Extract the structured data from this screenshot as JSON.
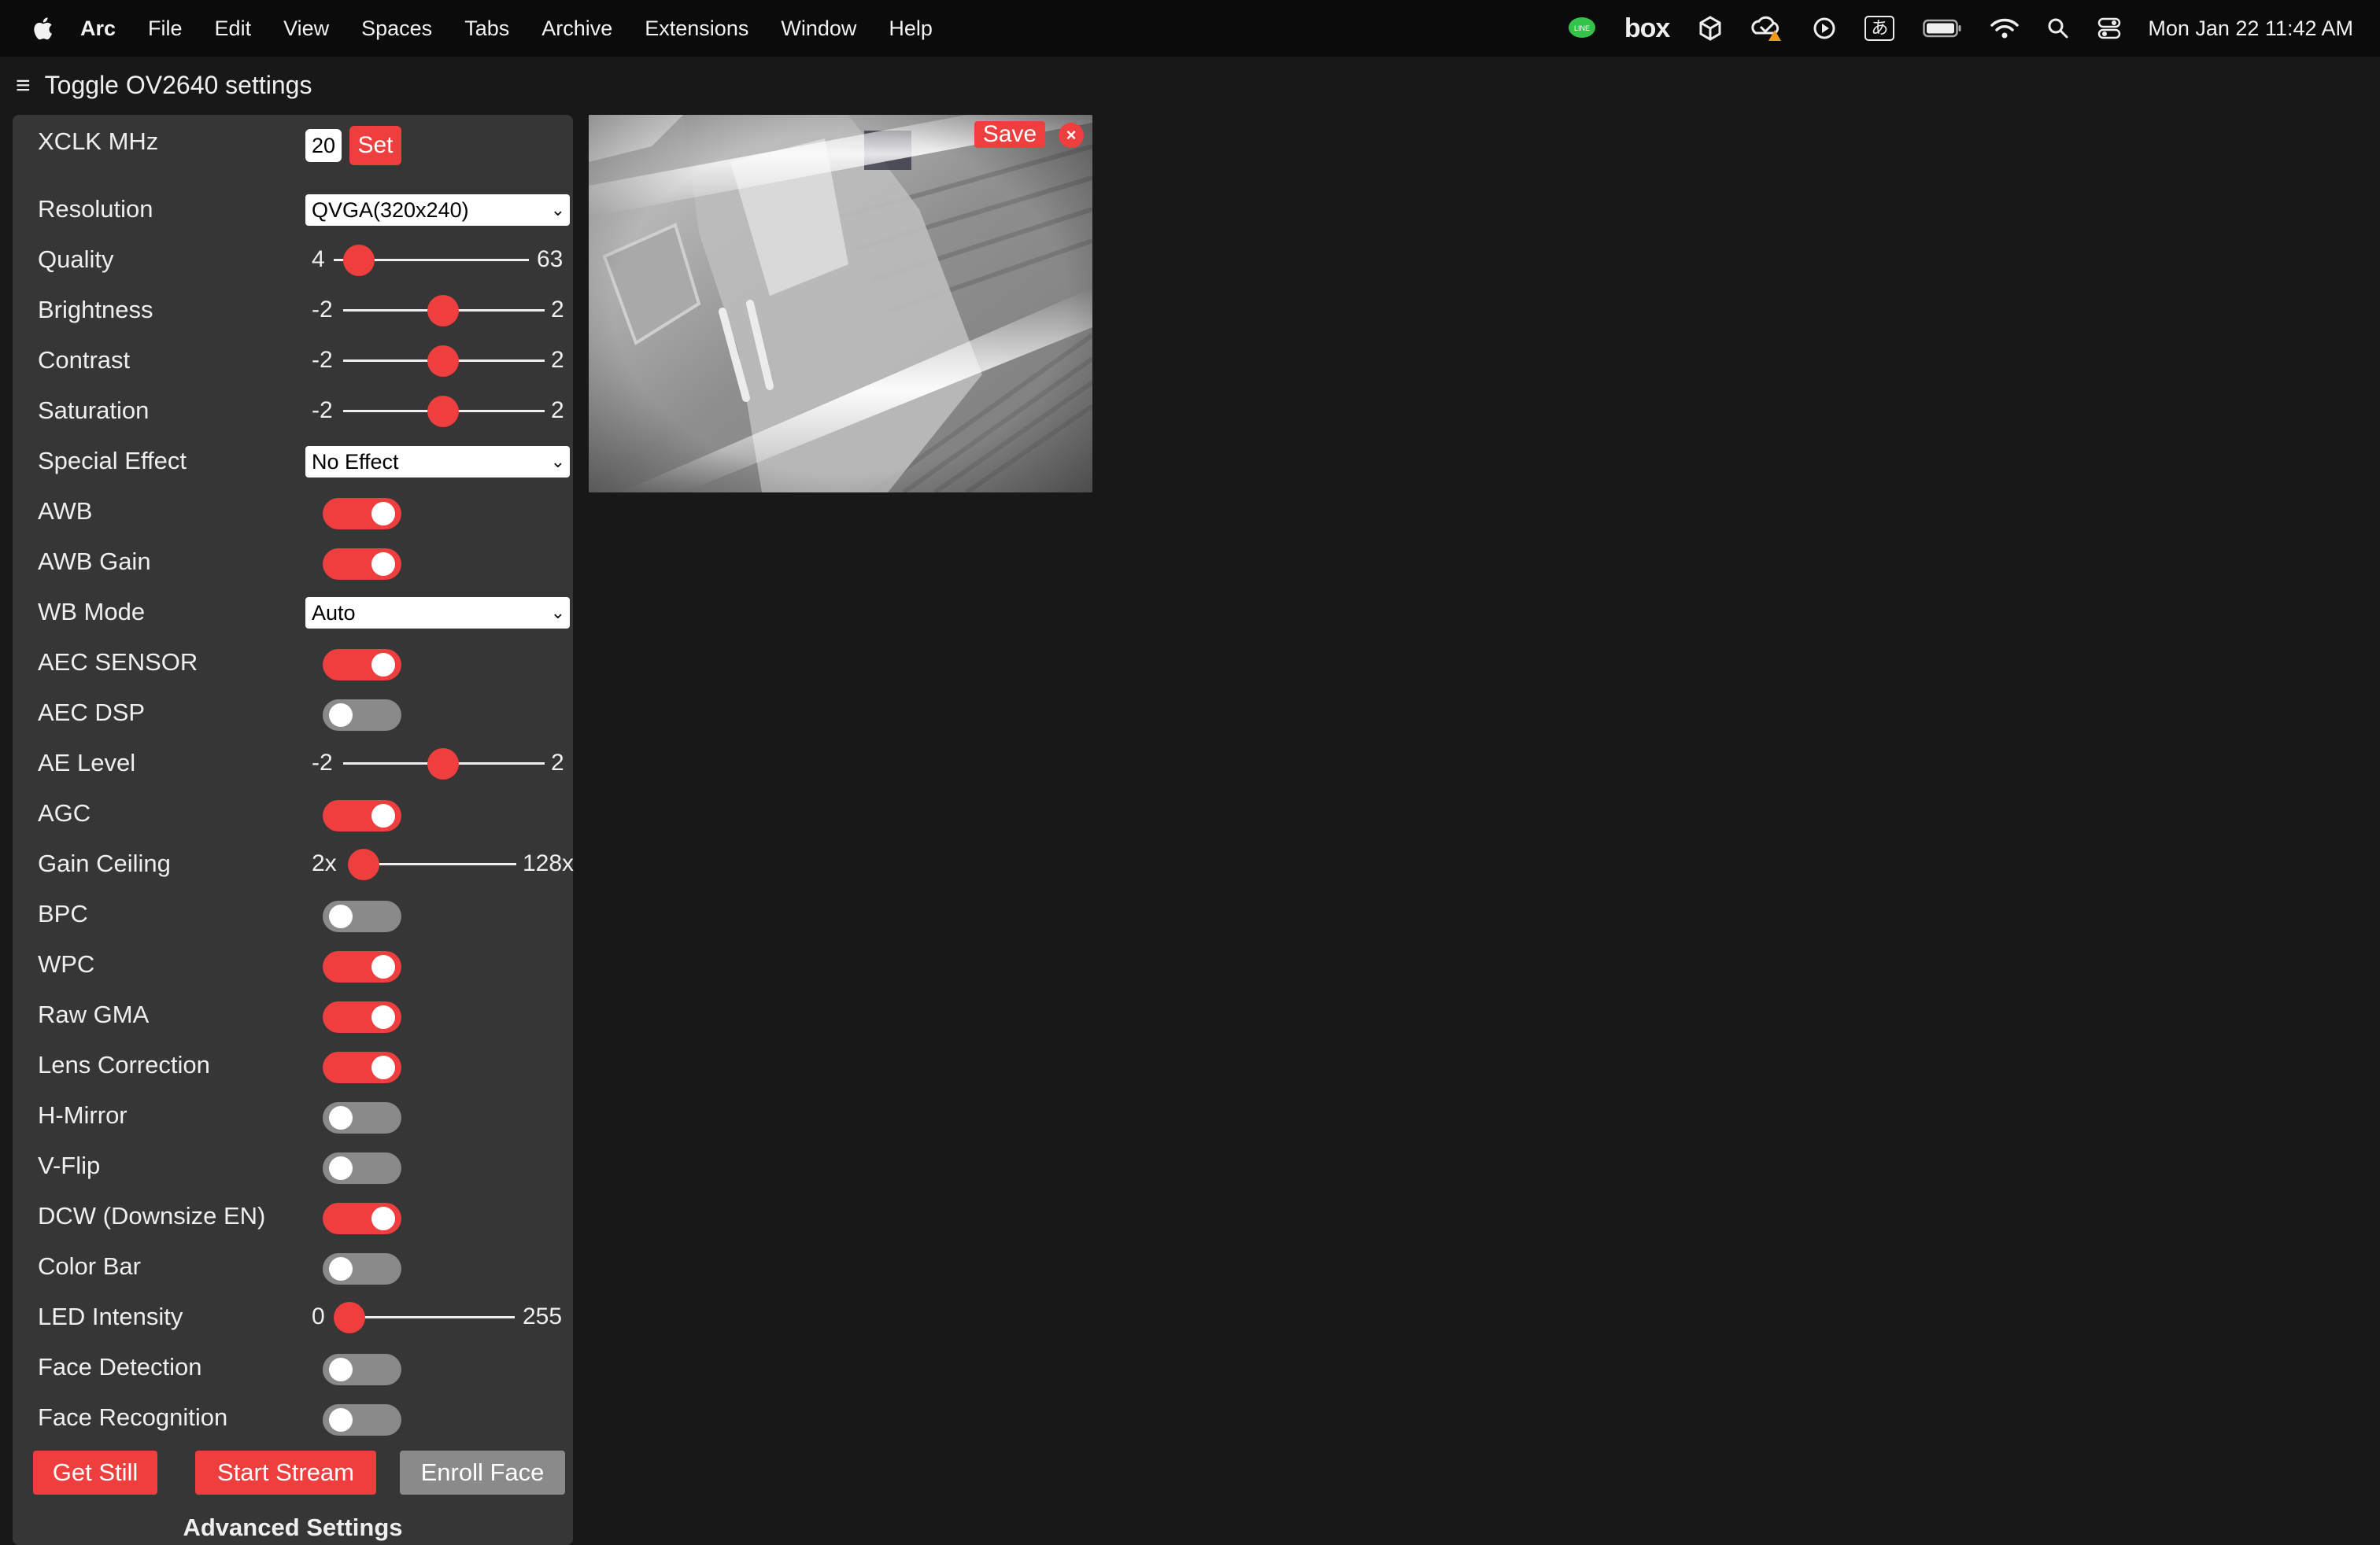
{
  "menubar": {
    "app": "Arc",
    "items": [
      "File",
      "Edit",
      "View",
      "Spaces",
      "Tabs",
      "Archive",
      "Extensions",
      "Window",
      "Help"
    ],
    "status_icons": [
      "line-icon",
      "box-icon",
      "unity-icon",
      "cloud-warning-icon",
      "play-icon",
      "input-method-icon",
      "battery-icon",
      "wifi-icon",
      "search-icon",
      "control-center-icon"
    ],
    "box_label": "box",
    "input_label": "あ",
    "clock": "Mon Jan 22  11:42 AM"
  },
  "header": {
    "menu_glyph": "≡",
    "title": "Toggle OV2640 settings"
  },
  "settings": {
    "xclk": {
      "label": "XCLK MHz",
      "value": "20",
      "set_label": "Set"
    },
    "resolution": {
      "label": "Resolution",
      "selected": "QVGA(320x240)"
    },
    "quality": {
      "label": "Quality",
      "min": "4",
      "max": "63",
      "value": 10
    },
    "brightness": {
      "label": "Brightness",
      "min": "-2",
      "max": "2",
      "value": 0
    },
    "contrast": {
      "label": "Contrast",
      "min": "-2",
      "max": "2",
      "value": 0
    },
    "saturation": {
      "label": "Saturation",
      "min": "-2",
      "max": "2",
      "value": 0
    },
    "special_effect": {
      "label": "Special Effect",
      "selected": "No Effect"
    },
    "awb": {
      "label": "AWB",
      "on": true
    },
    "awb_gain": {
      "label": "AWB Gain",
      "on": true
    },
    "wb_mode": {
      "label": "WB Mode",
      "selected": "Auto"
    },
    "aec_sensor": {
      "label": "AEC SENSOR",
      "on": true
    },
    "aec_dsp": {
      "label": "AEC DSP",
      "on": false
    },
    "ae_level": {
      "label": "AE Level",
      "min": "-2",
      "max": "2",
      "value": 0
    },
    "agc": {
      "label": "AGC",
      "on": true
    },
    "gain_ceiling": {
      "label": "Gain Ceiling",
      "min": "2x",
      "max": "128x",
      "value": 0
    },
    "bpc": {
      "label": "BPC",
      "on": false
    },
    "wpc": {
      "label": "WPC",
      "on": true
    },
    "raw_gma": {
      "label": "Raw GMA",
      "on": true
    },
    "lens_correction": {
      "label": "Lens Correction",
      "on": true
    },
    "h_mirror": {
      "label": "H-Mirror",
      "on": false
    },
    "v_flip": {
      "label": "V-Flip",
      "on": false
    },
    "dcw": {
      "label": "DCW (Downsize EN)",
      "on": true
    },
    "color_bar": {
      "label": "Color Bar",
      "on": false
    },
    "led_intensity": {
      "label": "LED Intensity",
      "min": "0",
      "max": "255",
      "value": 0
    },
    "face_detection": {
      "label": "Face Detection",
      "on": false
    },
    "face_recognition": {
      "label": "Face Recognition",
      "on": false
    }
  },
  "buttons": {
    "get_still": "Get Still",
    "start_stream": "Start Stream",
    "enroll_face": "Enroll Face"
  },
  "advanced_title": "Advanced Settings",
  "stream": {
    "save_label": "Save",
    "close_glyph": "×"
  },
  "colors": {
    "accent": "#ee3e3e",
    "panel": "#363636",
    "background": "#181818",
    "toggle_off": "#8a8a8a"
  }
}
